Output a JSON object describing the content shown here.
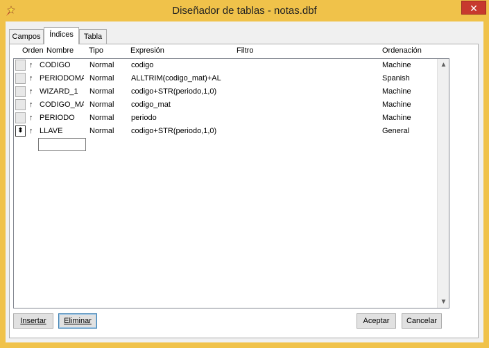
{
  "window": {
    "title": "Diseñador de tablas - notas.dbf",
    "close_symbol": "✕",
    "icon": "wizard-app-icon",
    "accent": "#f0c24a",
    "close_color": "#c7392e"
  },
  "tabs": [
    {
      "label": "Campos",
      "active": false
    },
    {
      "label": "Índices",
      "active": true
    },
    {
      "label": "Tabla",
      "active": false
    }
  ],
  "columns": {
    "orden": "Orden",
    "nombre": "Nombre",
    "tipo": "Tipo",
    "expresion": "Expresión",
    "filtro": "Filtro",
    "ordenacion": "Ordenación"
  },
  "rows": [
    {
      "direction": "↑",
      "nombre": "CODIGO",
      "tipo": "Normal",
      "expresion": "codigo",
      "filtro": "",
      "ordenacion": "Machine"
    },
    {
      "direction": "↑",
      "nombre": "PERIODOMA",
      "tipo": "Normal",
      "expresion": "ALLTRIM(codigo_mat)+AL",
      "filtro": "",
      "ordenacion": "Spanish"
    },
    {
      "direction": "↑",
      "nombre": "WIZARD_1",
      "tipo": "Normal",
      "expresion": "codigo+STR(periodo,1,0)",
      "filtro": "",
      "ordenacion": "Machine"
    },
    {
      "direction": "↑",
      "nombre": "CODIGO_MA",
      "tipo": "Normal",
      "expresion": "codigo_mat",
      "filtro": "",
      "ordenacion": "Machine"
    },
    {
      "direction": "↑",
      "nombre": "PERIODO",
      "tipo": "Normal",
      "expresion": "periodo",
      "filtro": "",
      "ordenacion": "Machine"
    },
    {
      "direction": "↑",
      "nombre": "LLAVE",
      "tipo": "Normal",
      "expresion": "codigo+STR(periodo,1,0)",
      "filtro": "",
      "ordenacion": "General"
    }
  ],
  "current_row_marker": "⬍",
  "scroll": {
    "up": "▲",
    "down": "▼"
  },
  "buttons": {
    "insertar": "Insertar",
    "eliminar": "Eliminar",
    "aceptar": "Aceptar",
    "cancelar": "Cancelar"
  }
}
